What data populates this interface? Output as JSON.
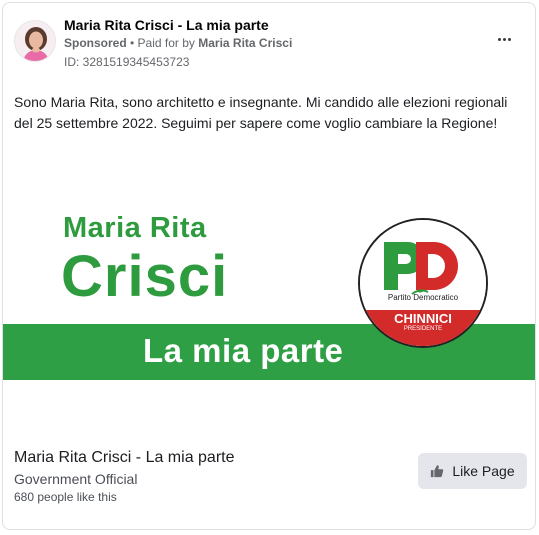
{
  "post": {
    "page_name": "Maria Rita Crisci - La mia parte",
    "sponsored_label": "Sponsored",
    "separator": " • ",
    "paid_for_prefix": "Paid for by ",
    "payer": "Maria Rita Crisci",
    "ad_id": "ID: 3281519345453723",
    "body_text": "Sono Maria Rita, sono architetto e insegnante. Mi candido alle elezioni regionali del 25 settembre 2022. Seguimi per sapere come voglio cambiare la Regione!",
    "more_icon": "more-horizontal-icon"
  },
  "creative": {
    "line1": "Maria Rita",
    "line2": "Crisci",
    "slogan": "La mia parte",
    "green": "#2e9b3e",
    "logo": {
      "letters": "PD",
      "party_text": "Partito Democratico",
      "candidate": "CHINNICI",
      "candidate_role": "PRESIDENTE",
      "red": "#d32a2a"
    }
  },
  "footer": {
    "page_name": "Maria Rita Crisci - La mia parte",
    "category": "Government Official",
    "likes": "680 people like this",
    "like_button": "Like Page",
    "like_icon": "thumbs-up-icon"
  }
}
